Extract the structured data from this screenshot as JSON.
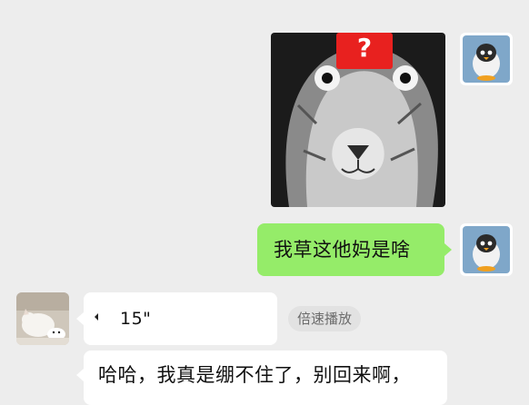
{
  "chat": {
    "messages": [
      {
        "from": "me",
        "kind": "sticker",
        "sticker_icon": "lion-face-question-mark-sticker",
        "badge_text": "?"
      },
      {
        "from": "me",
        "kind": "text",
        "text": "我草这他妈是啥"
      },
      {
        "from": "other",
        "kind": "voice",
        "duration": "15\"",
        "speed_label": "倍速播放"
      },
      {
        "from": "other",
        "kind": "text",
        "text": "哈哈，我真是绷不住了，别回来啊，"
      }
    ]
  },
  "avatars": {
    "me_icon": "penguin-avatar",
    "other_icon": "cat-avatar"
  },
  "colors": {
    "background": "#ededed",
    "my_bubble": "#95ec69",
    "other_bubble": "#ffffff",
    "badge_red": "#e8211f"
  }
}
